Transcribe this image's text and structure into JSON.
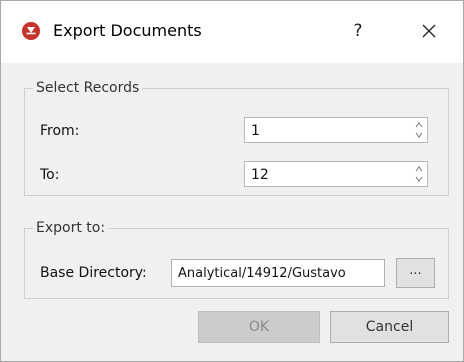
{
  "dialog": {
    "title": "Export Documents",
    "help_label": "?",
    "app_icon": "app-logo-icon",
    "close_icon": "close-icon"
  },
  "select_records": {
    "legend": "Select Records",
    "from_label": "From:",
    "from_value": "1",
    "to_label": "To:",
    "to_value": "12"
  },
  "export_to": {
    "legend": "Export to:",
    "base_directory_label": "Base Directory:",
    "base_directory_value": "Analytical/14912/Gustavo",
    "browse_label": "..."
  },
  "buttons": {
    "ok_label": "OK",
    "cancel_label": "Cancel"
  },
  "colors": {
    "app_icon": "#c8322b",
    "ok_disabled_bg": "#cccccc",
    "ok_disabled_text": "#8a8a8a"
  }
}
